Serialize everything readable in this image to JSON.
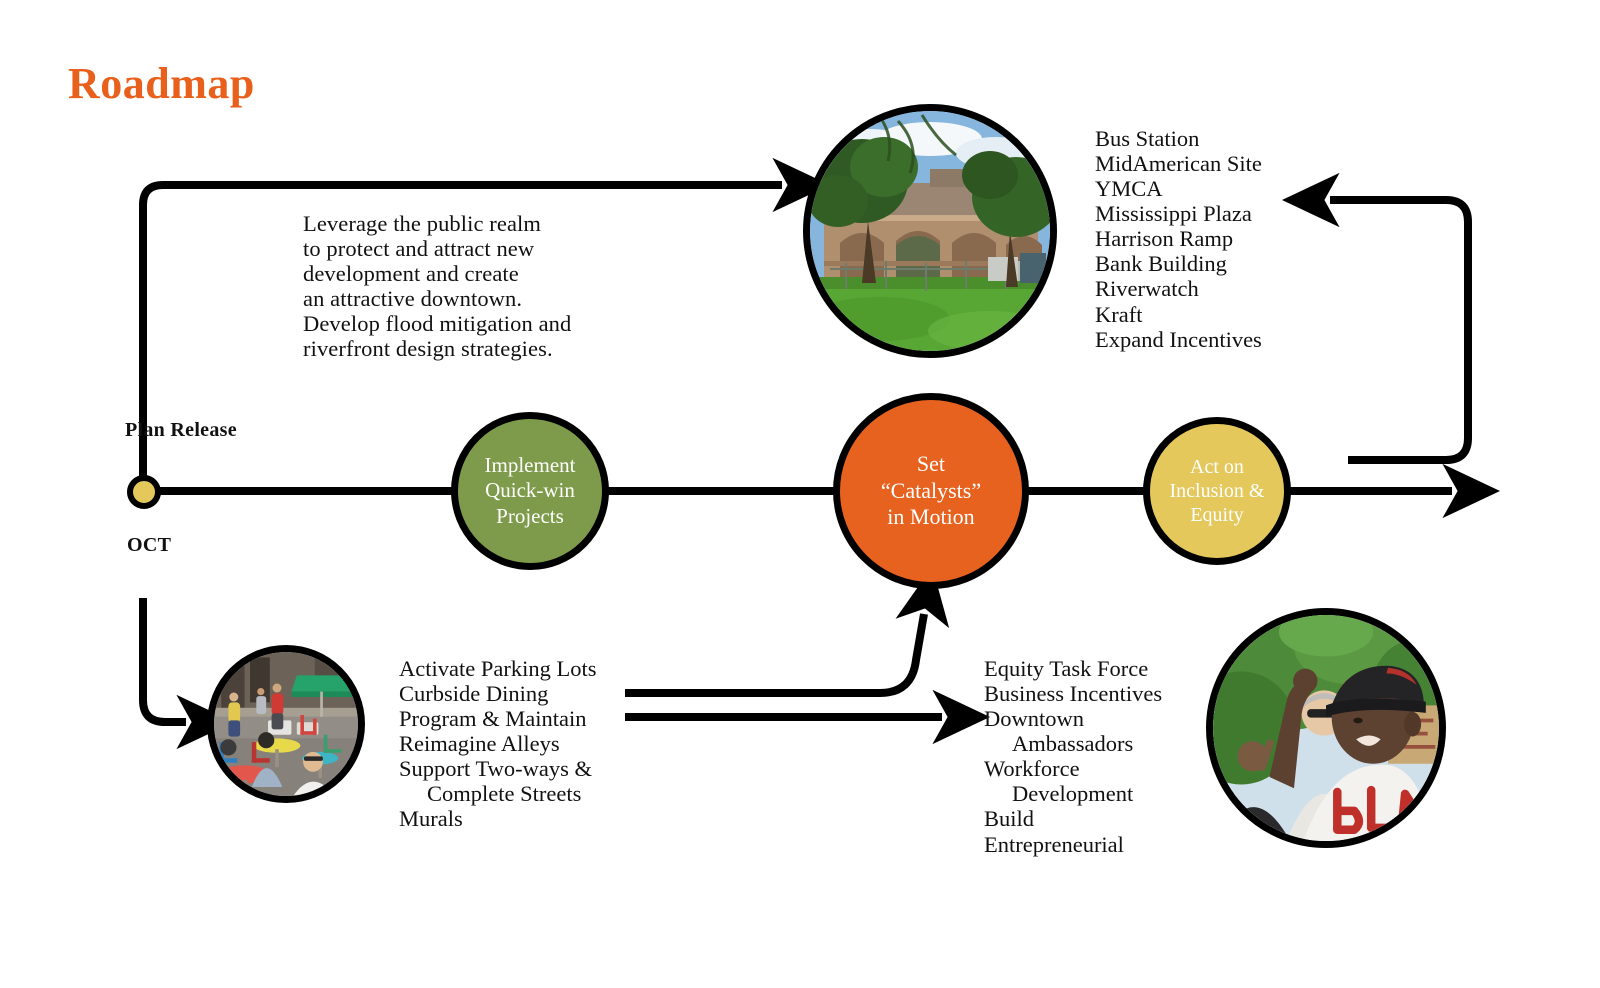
{
  "page": {
    "title": "Roadmap",
    "title_color": "#E8601C",
    "background": "#FFFFFF"
  },
  "palette": {
    "orange": "#E8621F",
    "green": "#7D9B4A",
    "yellow": "#E4C85C",
    "line": "#000000",
    "text": "#111111",
    "node_text": "#FFFFFF"
  },
  "timeline": {
    "start": {
      "caption_above": "Plan Release",
      "caption_below": "OCT",
      "dot_color": "#E4C85C"
    },
    "nodes": [
      {
        "id": "quick-win",
        "label": "Implement\nQuick-win\nProjects",
        "color": "#7D9B4A"
      },
      {
        "id": "catalysts",
        "label": "Set\n“Catalysts”\nin Motion",
        "color": "#E8621F"
      },
      {
        "id": "inclusion-equity",
        "label": "Act on\nInclusion &\nEquity",
        "color": "#E4C85C"
      }
    ]
  },
  "public_realm": {
    "text": "Leverage the public realm\nto protect and attract new\ndevelopment and create\nan attractive downtown.\nDevelop flood mitigation and\nriverfront design strategies."
  },
  "catalyst_list": {
    "items": [
      {
        "text": "Bus Station",
        "indent": false
      },
      {
        "text": "MidAmerican Site",
        "indent": false
      },
      {
        "text": "YMCA",
        "indent": false
      },
      {
        "text": "Mississippi Plaza",
        "indent": false
      },
      {
        "text": "Harrison Ramp",
        "indent": false
      },
      {
        "text": "Bank Building",
        "indent": false
      },
      {
        "text": "Riverwatch",
        "indent": false
      },
      {
        "text": "Kraft",
        "indent": false
      },
      {
        "text": "Expand Incentives",
        "indent": false
      }
    ]
  },
  "quickwin_list": {
    "items": [
      {
        "text": "Activate Parking Lots",
        "indent": false
      },
      {
        "text": "Curbside Dining",
        "indent": false
      },
      {
        "text": "Program & Maintain",
        "indent": false
      },
      {
        "text": "Reimagine Alleys",
        "indent": false
      },
      {
        "text": "Support Two-ways &",
        "indent": false
      },
      {
        "text": "Complete Streets",
        "indent": true
      },
      {
        "text": "Murals",
        "indent": false
      }
    ]
  },
  "equity_list": {
    "items": [
      {
        "text": "Equity Task Force",
        "indent": false
      },
      {
        "text": "Business Incentives",
        "indent": false
      },
      {
        "text": "Downtown",
        "indent": false
      },
      {
        "text": "Ambassadors",
        "indent": true
      },
      {
        "text": "Workforce",
        "indent": false
      },
      {
        "text": "Development",
        "indent": true
      },
      {
        "text": "Build",
        "indent": false
      },
      {
        "text": "Entrepreneurial",
        "indent": false
      }
    ]
  },
  "photos": {
    "riverfront": {
      "alt": "Grassy lot with brick arched building and trees under a blue sky"
    },
    "dining": {
      "alt": "People seated at colorful outdoor bistro tables on a closed street with a green canopy"
    },
    "equity": {
      "alt": "Young person in a BLM shirt and cap raising a fist at an outdoor rally"
    }
  }
}
